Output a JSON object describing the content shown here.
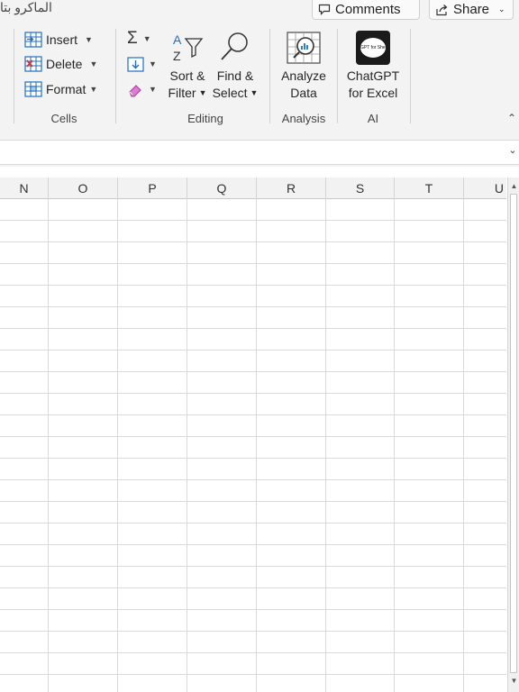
{
  "ribbon": {
    "doc_title_fragment": "الماكرو بتا",
    "comments_label": "Comments",
    "share_label": "Share",
    "cells": {
      "insert_label": "Insert",
      "delete_label": "Delete",
      "format_label": "Format",
      "group_label": "Cells"
    },
    "editing": {
      "sort_label_line1": "Sort &",
      "sort_label_line2": "Filter",
      "find_label_line1": "Find &",
      "find_label_line2": "Select",
      "group_label": "Editing"
    },
    "analysis": {
      "analyze_line1": "Analyze",
      "analyze_line2": "Data",
      "group_label": "Analysis"
    },
    "ai": {
      "chatgpt_line1": "ChatGPT",
      "chatgpt_line2": "for Excel",
      "logo_text": "GPT for Sheets",
      "group_label": "AI"
    }
  },
  "grid": {
    "columns": [
      "N",
      "O",
      "P",
      "Q",
      "R",
      "S",
      "T",
      "U"
    ]
  },
  "colors": {
    "ribbon_bg": "#f3f3f3",
    "gridline": "#dadada",
    "header_bg": "#f2f2f2",
    "accent_blue": "#1e6fc4",
    "delete_red": "#d13438"
  }
}
